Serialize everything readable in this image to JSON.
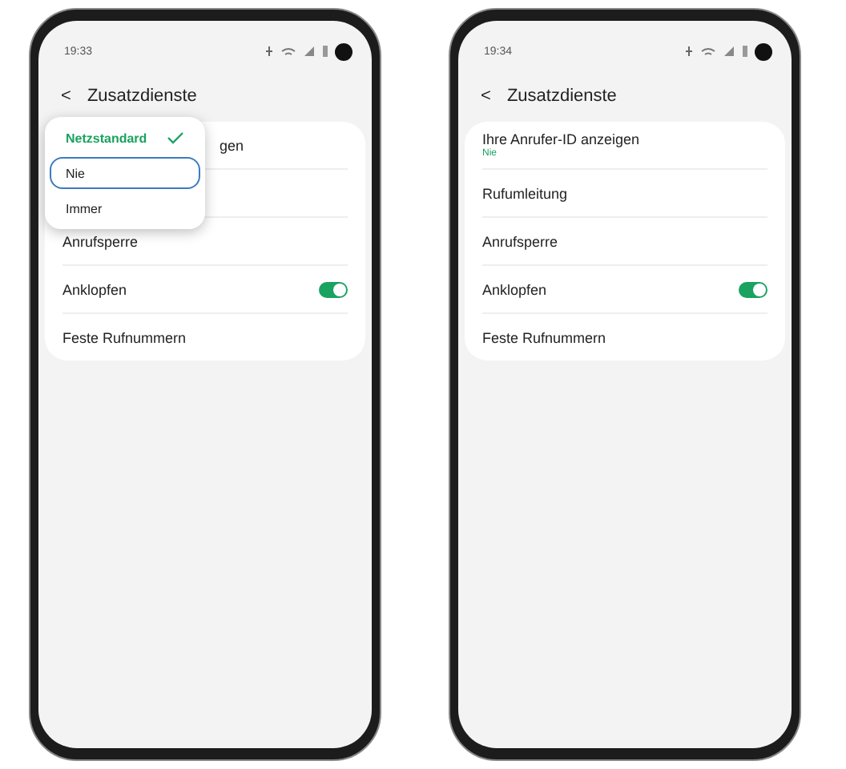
{
  "phones": [
    {
      "status_bar": {
        "time": "19:33"
      },
      "header": {
        "back": "<",
        "title": "Zusatzdienste"
      },
      "items": [
        {
          "kind": "covered",
          "title": "gen"
        },
        {
          "kind": "hidden"
        },
        {
          "kind": "plain",
          "title": "Anrufsperre"
        },
        {
          "kind": "toggle",
          "title": "Anklopfen",
          "on": true
        },
        {
          "kind": "plain",
          "title": "Feste Rufnummern"
        }
      ],
      "popup": {
        "options": [
          {
            "label": "Netzstandard",
            "selected": true,
            "focused": false
          },
          {
            "label": "Nie",
            "selected": false,
            "focused": true
          },
          {
            "label": "Immer",
            "selected": false,
            "focused": false
          }
        ]
      }
    },
    {
      "status_bar": {
        "time": "19:34"
      },
      "header": {
        "back": "<",
        "title": "Zusatzdienste"
      },
      "items": [
        {
          "kind": "plain",
          "title": "Ihre Anrufer-ID anzeigen",
          "subtitle": "Nie"
        },
        {
          "kind": "plain",
          "title": "Rufumleitung"
        },
        {
          "kind": "plain",
          "title": "Anrufsperre"
        },
        {
          "kind": "toggle",
          "title": "Anklopfen",
          "on": true
        },
        {
          "kind": "plain",
          "title": "Feste Rufnummern"
        }
      ]
    }
  ]
}
